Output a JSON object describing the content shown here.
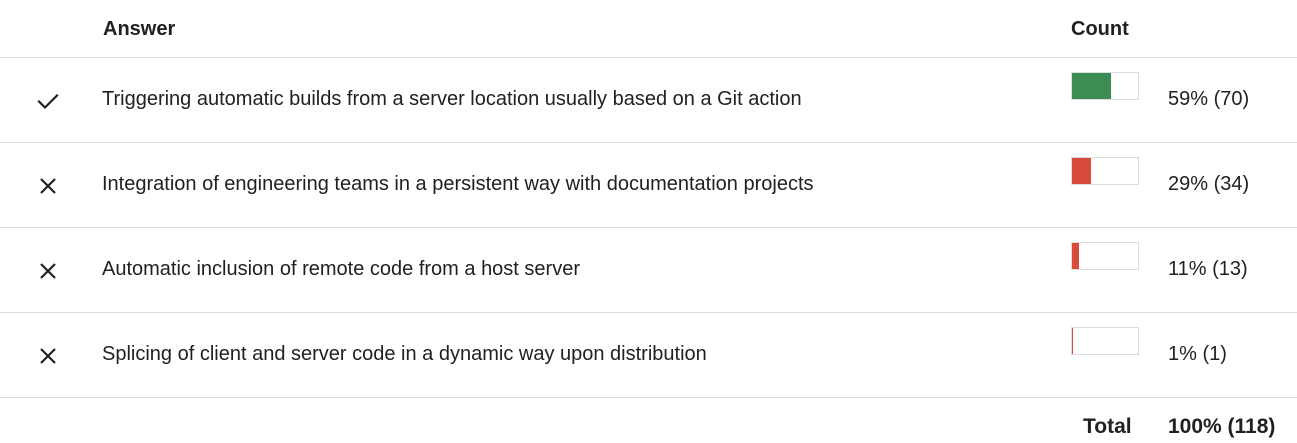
{
  "header": {
    "answer_label": "Answer",
    "count_label": "Count"
  },
  "colors": {
    "correct": "#3d8c53",
    "incorrect": "#d84a3c",
    "mark": "#202124",
    "divider": "#dadce0"
  },
  "answers": [
    {
      "text": "Triggering automatic builds from a server location usually based on a Git action",
      "status": "correct",
      "icon": "check-icon",
      "percent": 59,
      "count_text": "59% (70)"
    },
    {
      "text": "Integration of engineering teams in a persistent way with documentation projects",
      "status": "incorrect",
      "icon": "cross-icon",
      "percent": 29,
      "count_text": "29% (34)"
    },
    {
      "text": "Automatic inclusion of remote code from a host server",
      "status": "incorrect",
      "icon": "cross-icon",
      "percent": 11,
      "count_text": "11% (13)"
    },
    {
      "text": "Splicing of client and server code in a dynamic way upon distribution",
      "status": "incorrect",
      "icon": "cross-icon",
      "percent": 1,
      "count_text": "1% (1)"
    }
  ],
  "total": {
    "label": "Total",
    "value": "100% (118)"
  }
}
